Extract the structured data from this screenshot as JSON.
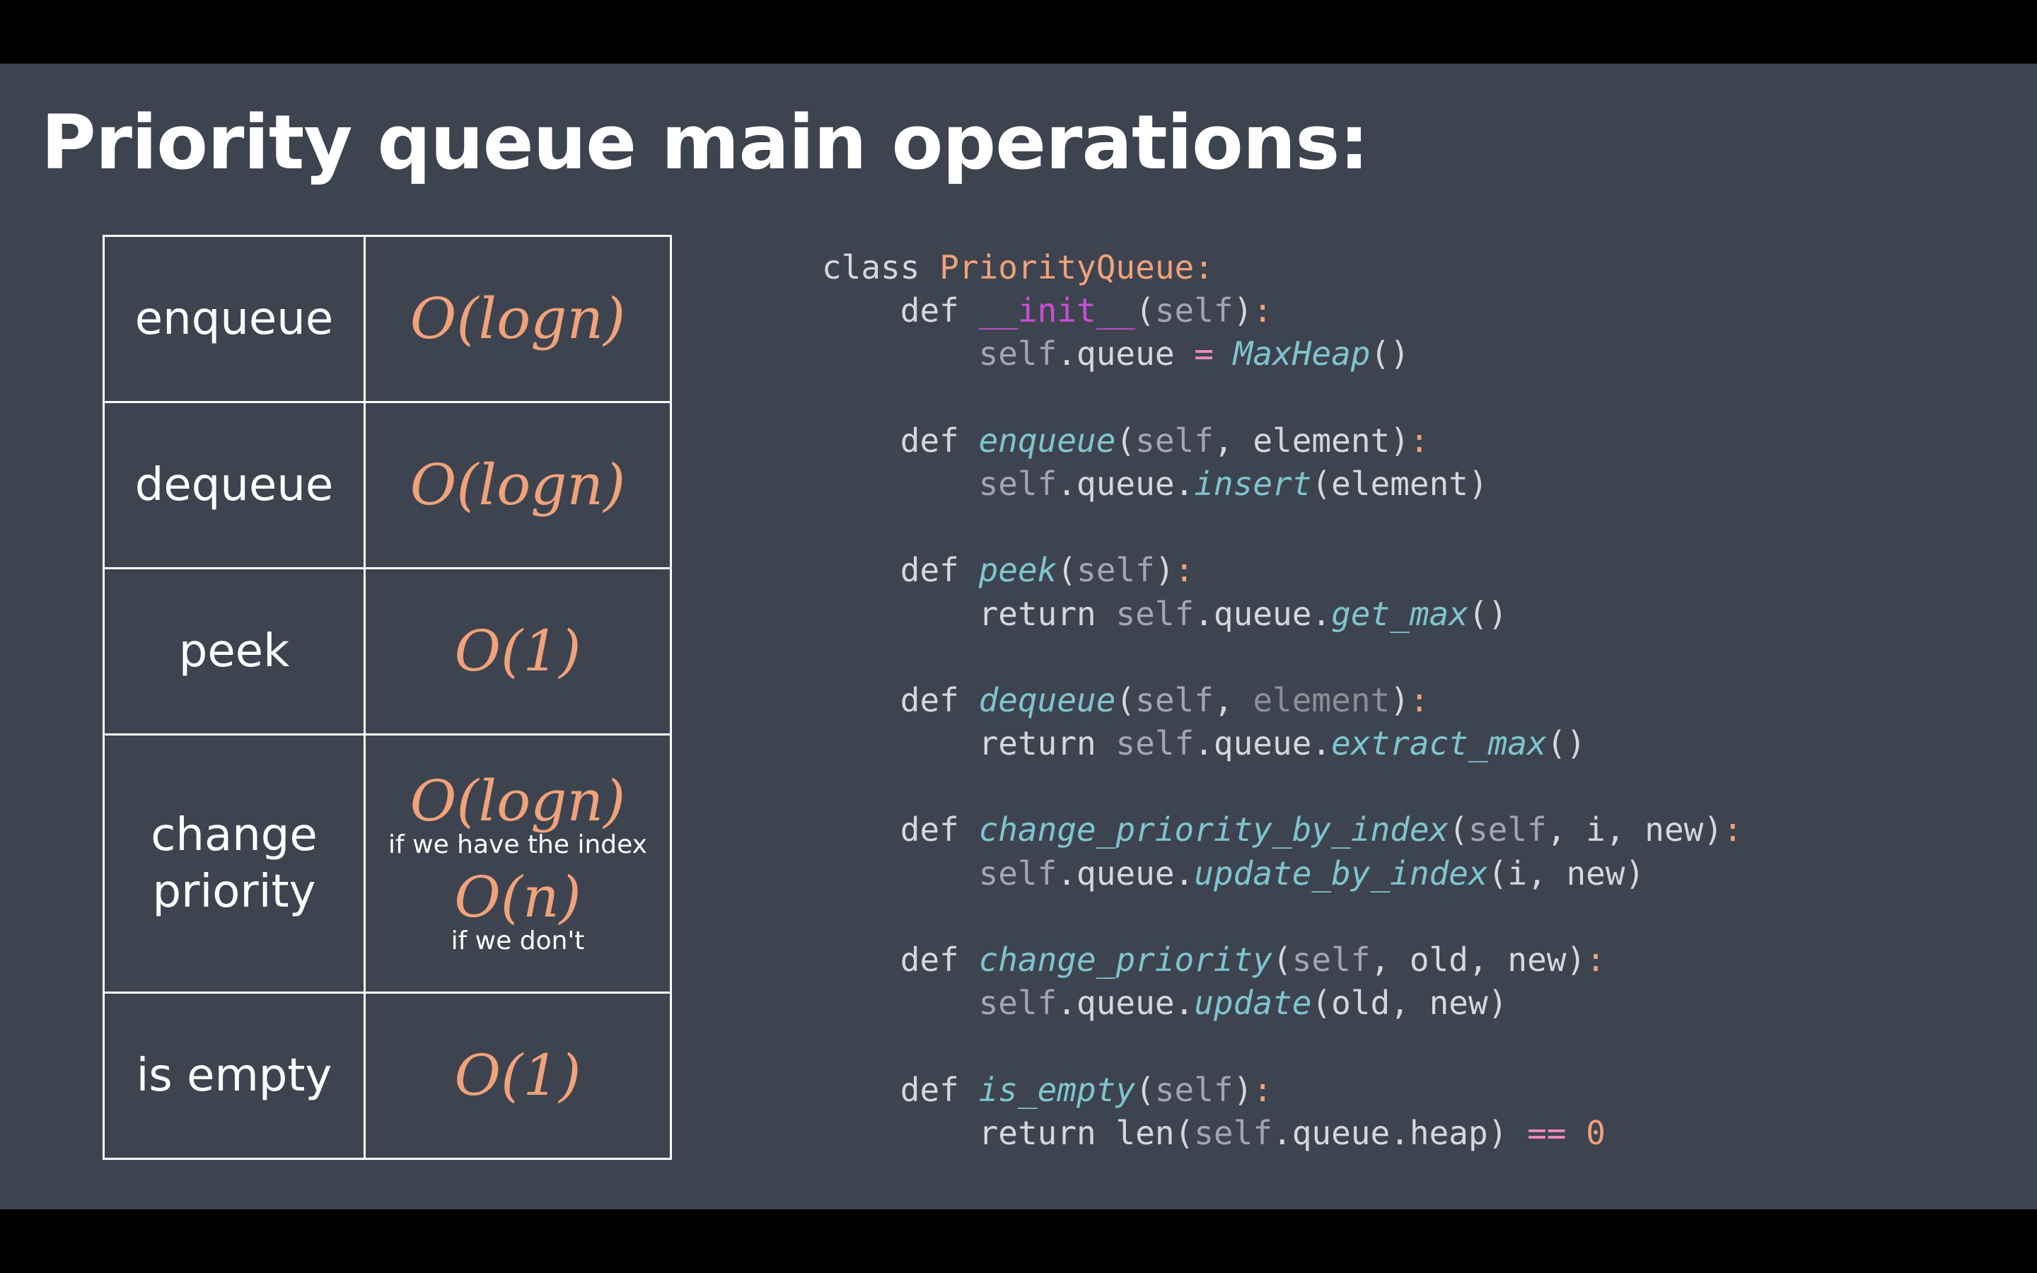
{
  "slide": {
    "title": "Priority queue main operations:"
  },
  "operations": [
    {
      "name": "enqueue",
      "cost": "O(logn)"
    },
    {
      "name": "dequeue",
      "cost": "O(logn)"
    },
    {
      "name": "peek",
      "cost": "O(1)"
    },
    {
      "name": "change priority",
      "cost_with_index": "O(logn)",
      "note_with_index": "if we have the index",
      "cost_without_index": "O(n)",
      "note_without_index": "if we don't"
    },
    {
      "name": "is empty",
      "cost": "O(1)"
    }
  ],
  "code": {
    "language": "python",
    "lines": [
      "class PriorityQueue:",
      "    def __init__(self):",
      "        self.queue = MaxHeap()",
      "",
      "    def enqueue(self, element):",
      "        self.queue.insert(element)",
      "",
      "    def peek(self):",
      "        return self.queue.get_max()",
      "",
      "    def dequeue(self, element):",
      "        return self.queue.extract_max()",
      "",
      "    def change_priority_by_index(self, i, new):",
      "        self.queue.update_by_index(i, new)",
      "",
      "    def change_priority(self, old, new):",
      "        self.queue.update(old, new)",
      "",
      "    def is_empty(self):",
      "        return len(self.queue.heap) == 0"
    ]
  },
  "colors": {
    "slide_background": "#3d444f",
    "letterbox": "#000000",
    "title_text": "#ffffff",
    "complexity_text": "#f0a27a",
    "code_text": "#d4d7de",
    "code_function_name": "#7fc4cf",
    "code_dunder": "#c94ed6",
    "code_self": "#a5a3b4",
    "code_operator": "#ef8ab8"
  }
}
